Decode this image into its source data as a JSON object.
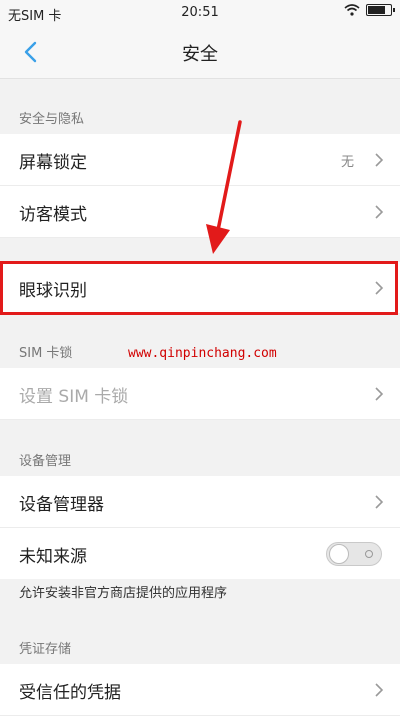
{
  "status_bar": {
    "carrier": "无SIM 卡",
    "time": "20:51"
  },
  "nav": {
    "title": "安全"
  },
  "sections": {
    "privacy": {
      "header": "安全与隐私",
      "screen_lock": {
        "label": "屏幕锁定",
        "value": "无"
      },
      "guest_mode": {
        "label": "访客模式"
      }
    },
    "eye": {
      "eye_recognition": {
        "label": "眼球识别"
      }
    },
    "sim": {
      "header": "SIM 卡锁",
      "set_sim_lock": {
        "label": "设置 SIM 卡锁"
      }
    },
    "device": {
      "header": "设备管理",
      "device_admin": {
        "label": "设备管理器"
      },
      "unknown_sources": {
        "label": "未知来源",
        "enabled": false
      },
      "unknown_sources_hint": "允许安装非官方商店提供的应用程序"
    },
    "credentials": {
      "header": "凭证存储",
      "trusted": {
        "label": "受信任的凭据"
      }
    }
  },
  "watermark": "www.qinpinchang.com",
  "colors": {
    "accent": "#3aa0e8",
    "highlight": "#e21a1a",
    "watermark": "#d10000"
  },
  "battery_level": 0.85
}
